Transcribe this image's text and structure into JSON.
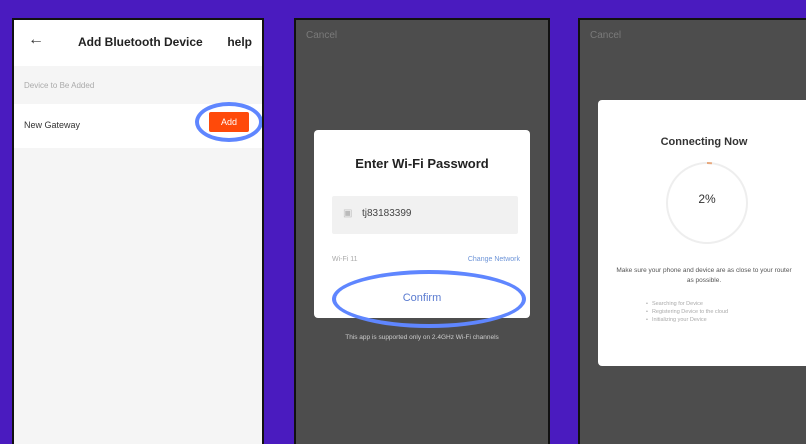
{
  "screen1": {
    "header": {
      "title": "Add Bluetooth Device",
      "help": "help"
    },
    "section_label": "Device to Be Added",
    "device": {
      "name": "New Gateway",
      "add_label": "Add"
    }
  },
  "screen2": {
    "cancel": "Cancel",
    "modal": {
      "title": "Enter Wi-Fi Password",
      "password_value": "tj83183399",
      "wifi_label": "Wi-Fi 11",
      "change_network": "Change Network",
      "confirm": "Confirm"
    },
    "note": "This app is supported only on 2.4GHz Wi-Fi channels"
  },
  "screen3": {
    "cancel": "Cancel",
    "modal": {
      "title": "Connecting Now",
      "progress": "2%",
      "progress_fraction": 0.02,
      "message": "Make sure your phone and device are as close to your router as possible.",
      "steps": [
        "Searching for Device",
        "Registering Device to the cloud",
        "Initializing your Device"
      ]
    }
  },
  "colors": {
    "background": "#4a1bbf",
    "accent": "#ff4a0a",
    "highlight_ring": "#5f86ff",
    "link": "#5a7bd0"
  }
}
